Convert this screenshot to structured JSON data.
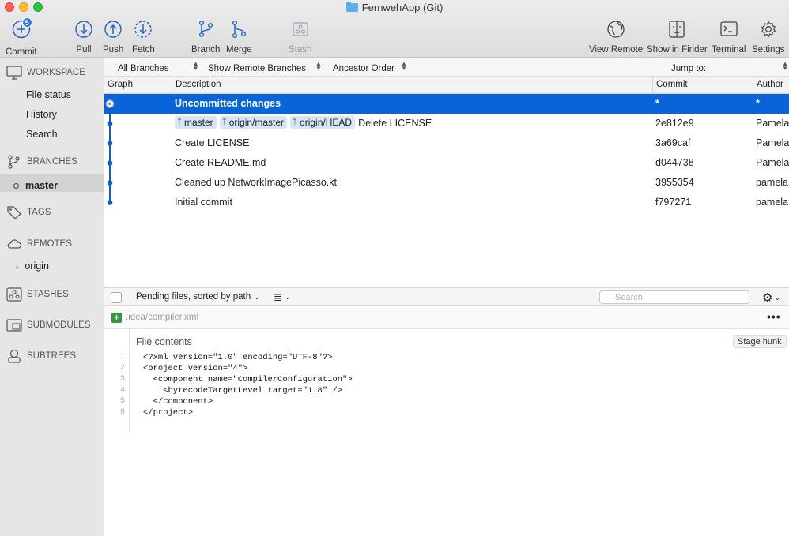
{
  "window": {
    "title": "FernwehApp (Git)"
  },
  "toolbar": {
    "commit_badge": "5",
    "buttons": {
      "commit": "Commit",
      "pull": "Pull",
      "push": "Push",
      "fetch": "Fetch",
      "branch": "Branch",
      "merge": "Merge",
      "stash": "Stash",
      "view_remote": "View Remote",
      "show_in_finder": "Show in Finder",
      "terminal": "Terminal",
      "settings": "Settings"
    }
  },
  "sidebar": {
    "workspace": {
      "header": "WORKSPACE",
      "items": [
        "File status",
        "History",
        "Search"
      ]
    },
    "branches": {
      "header": "BRANCHES",
      "items": [
        "master"
      ]
    },
    "tags": {
      "header": "TAGS"
    },
    "remotes": {
      "header": "REMOTES",
      "items": [
        "origin"
      ]
    },
    "stashes": {
      "header": "STASHES"
    },
    "submodules": {
      "header": "SUBMODULES"
    },
    "subtrees": {
      "header": "SUBTREES"
    }
  },
  "filters": {
    "branches": "All Branches",
    "remote": "Show Remote Branches",
    "order": "Ancestor Order",
    "jump_to": "Jump to:"
  },
  "columns": {
    "graph": "Graph",
    "description": "Description",
    "commit": "Commit",
    "author": "Author"
  },
  "commits": [
    {
      "refs": [],
      "description": "Uncommitted changes",
      "hash": "*",
      "author": "*"
    },
    {
      "refs": [
        "master",
        "origin/master",
        "origin/HEAD"
      ],
      "description": "Delete LICENSE",
      "hash": "2e812e9",
      "author": "Pamela"
    },
    {
      "refs": [],
      "description": "Create LICENSE",
      "hash": "3a69caf",
      "author": "Pamela"
    },
    {
      "refs": [],
      "description": "Create README.md",
      "hash": "d044738",
      "author": "Pamela"
    },
    {
      "refs": [],
      "description": "Cleaned up NetworkImagePicasso.kt",
      "hash": "3955354",
      "author": "pamela"
    },
    {
      "refs": [],
      "description": "Initial commit",
      "hash": "f797271",
      "author": "pamela"
    }
  ],
  "pending": {
    "label": "Pending files, sorted by path",
    "search_placeholder": "Search"
  },
  "file": {
    "name": ".idea/compiler.xml",
    "contents_title": "File contents",
    "stage_hunk": "Stage hunk",
    "lines": [
      {
        "n": "1",
        "text": "<?xml version=\"1.0\" encoding=\"UTF-8\"?>"
      },
      {
        "n": "2",
        "text": "<project version=\"4\">"
      },
      {
        "n": "3",
        "text": "  <component name=\"CompilerConfiguration\">"
      },
      {
        "n": "4",
        "text": "    <bytecodeTargetLevel target=\"1.8\" />"
      },
      {
        "n": "5",
        "text": "  </component>"
      },
      {
        "n": "6",
        "text": "</project>"
      }
    ]
  },
  "colors": {
    "selection": "#0864d8",
    "graph": "#0b5fc6",
    "added": "#2e9a3a",
    "badge": "#2f7de1"
  }
}
